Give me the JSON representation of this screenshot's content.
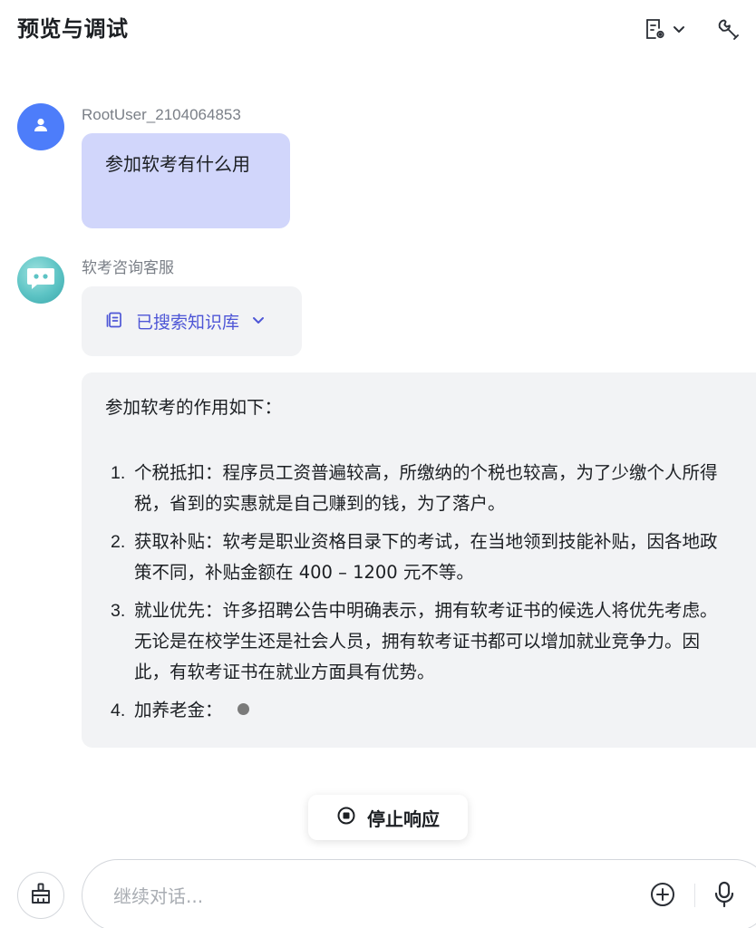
{
  "header": {
    "title": "预览与调试"
  },
  "conversation": {
    "user": {
      "name": "RootUser_2104064853",
      "message": "参加软考有什么用"
    },
    "bot": {
      "name": "软考咨询客服",
      "kb_status": "已搜索知识库",
      "intro": "参加软考的作用如下：",
      "items": [
        {
          "num": "1.",
          "text": "个税抵扣：程序员工资普遍较高，所缴纳的个税也较高，为了少缴个人所得税，省到的实惠就是自己赚到的钱，为了落户。"
        },
        {
          "num": "2.",
          "text": "获取补贴：软考是职业资格目录下的考试，在当地领到技能补贴，因各地政策不同，补贴金额在 400 – 1200 元不等。"
        },
        {
          "num": "3.",
          "text": "就业优先：许多招聘公告中明确表示，拥有软考证书的候选人将优先考虑。无论是在校学生还是社会人员，拥有软考证书都可以增加就业竞争力。因此，有软考证书在就业方面具有优势。"
        },
        {
          "num": "4.",
          "text": "加养老金："
        }
      ]
    }
  },
  "controls": {
    "stop_label": "停止响应"
  },
  "composer": {
    "placeholder": "继续对话..."
  },
  "colors": {
    "user_bubble": "#d1d6fb",
    "bot_bubble": "#f2f3f5",
    "accent": "#4e56d6",
    "user_avatar": "#4d7dfa"
  },
  "icons": [
    "document-settings-icon",
    "chevron-down-icon",
    "wrench-icon",
    "user-icon",
    "bot-icon",
    "knowledge-base-icon",
    "stop-icon",
    "broom-icon",
    "plus-circle-icon",
    "microphone-icon"
  ]
}
